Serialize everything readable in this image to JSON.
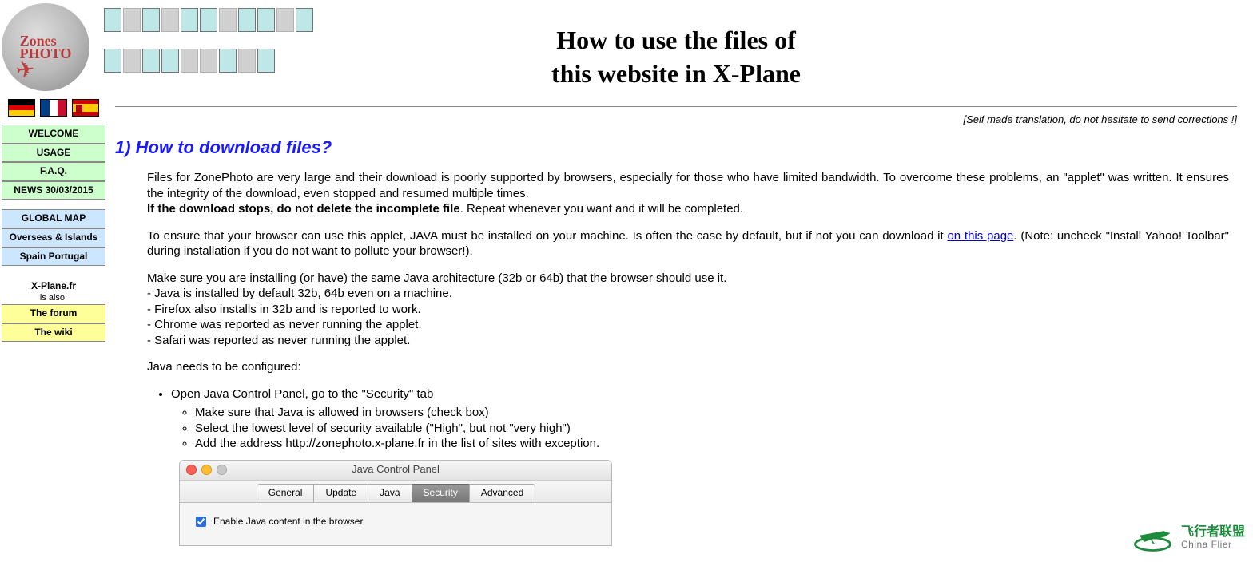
{
  "header": {
    "title_line1": "How to use the files of",
    "title_line2": "this website in X-Plane",
    "translation_note": "[Self made translation, do not hesitate to send corrections !]"
  },
  "sidebar": {
    "logo_text1": "Zones",
    "logo_text2": "PHOTO",
    "nav_green": [
      "WELCOME",
      "USAGE",
      "F.A.Q.",
      "NEWS 30/03/2015"
    ],
    "nav_blue": [
      "GLOBAL MAP",
      "Overseas & Islands",
      "Spain Portugal"
    ],
    "xplane_label": "X-Plane.fr",
    "xplane_sub": "is also:",
    "nav_yellow": [
      "The forum",
      "The wiki"
    ]
  },
  "section1": {
    "heading": "1) How to download files?",
    "p1": "Files for ZonePhoto are very large and their download is poorly supported by browsers, especially for those who have limited bandwidth. To overcome these problems, an \"applet\" was written. It ensures the integrity of the download, even stopped and resumed multiple times.",
    "p1b_bold": "If the download stops, do not delete the incomplete file",
    "p1b_rest": ". Repeat whenever you want and it will be completed.",
    "p2a": "To ensure that your browser can use this applet, JAVA must be installed on your machine. Is often the case by default, but if not you can download it ",
    "p2_link": "on this page",
    "p2b": ". (Note: uncheck \"Install Yahoo! Toolbar\" during installation if you do not want to pollute your browser!).",
    "p3_intro": "Make sure you are installing (or have) the same Java architecture (32b or 64b) that the browser should use it.",
    "p3_lines": [
      "- Java is installed by default 32b, 64b even on a machine.",
      "- Firefox also installs in 32b and is reported to work.",
      "- Chrome was reported as never running the applet.",
      "- Safari was reported as never running the applet."
    ],
    "p4": "Java needs to be configured:",
    "bullet1": "Open Java Control Panel, go to the \"Security\" tab",
    "sub_bullets": [
      "Make sure that Java is allowed in browsers (check box)",
      "Select the lowest level of security available (\"High\", but not \"very high\")",
      "Add the address http://zonephoto.x-plane.fr in the list of sites with exception."
    ]
  },
  "jcp": {
    "window_title": "Java Control Panel",
    "tabs": [
      "General",
      "Update",
      "Java",
      "Security",
      "Advanced"
    ],
    "active_tab": "Security",
    "checkbox_label": "Enable Java content in the browser"
  },
  "watermark": {
    "cn": "飞行者联盟",
    "en": "China Flier"
  }
}
